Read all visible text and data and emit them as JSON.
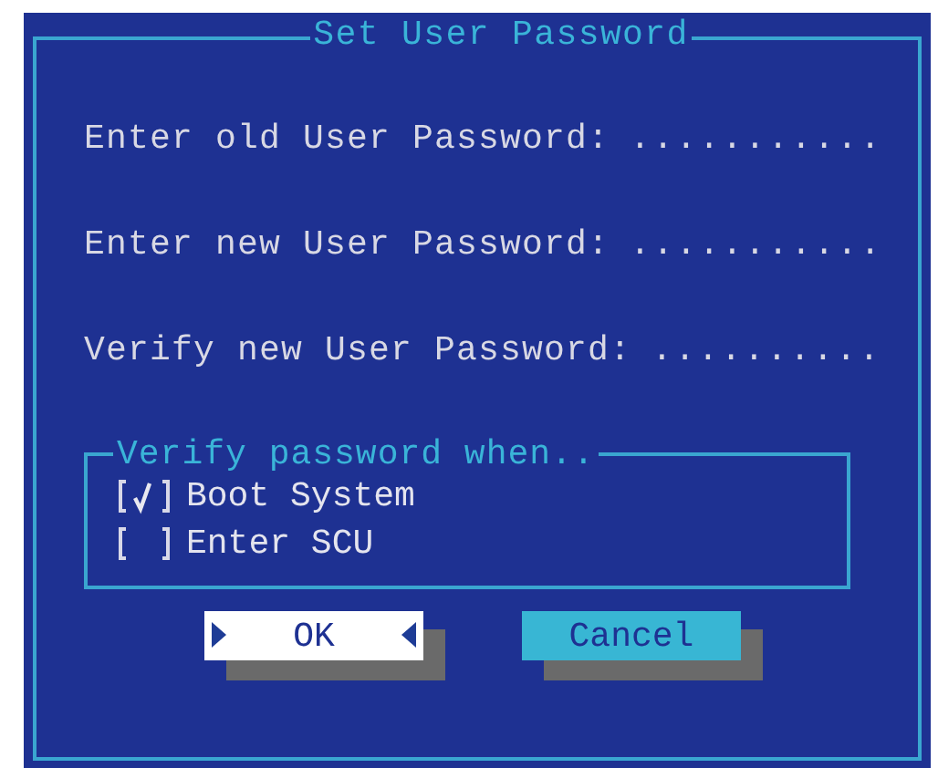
{
  "dialog": {
    "title": "Set User Password"
  },
  "fields": [
    {
      "label": "Enter old User Password:",
      "value": "..........."
    },
    {
      "label": "Enter new User Password:",
      "value": "..........."
    },
    {
      "label": "Verify new User Password:",
      "value": ".........."
    }
  ],
  "group": {
    "title": "Verify password when..",
    "options": [
      {
        "label": "Boot System",
        "checked": true
      },
      {
        "label": "Enter SCU",
        "checked": false
      }
    ]
  },
  "buttons": [
    {
      "label": "OK",
      "selected": true
    },
    {
      "label": "Cancel",
      "selected": false
    }
  ]
}
